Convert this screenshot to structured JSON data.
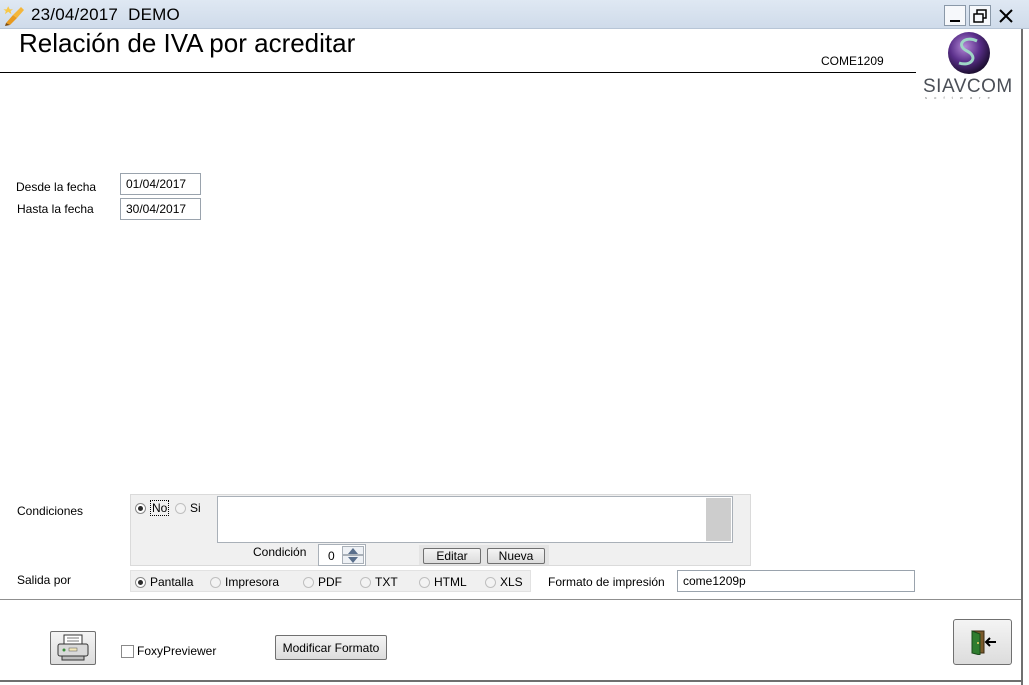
{
  "window": {
    "date": "23/04/2017",
    "company": "DEMO"
  },
  "header": {
    "title": "Relación de IVA por acreditar",
    "code": "COME1209",
    "logo_text": "SIAVCOM",
    "logo_subtext": "s o f t w a r e"
  },
  "dates": {
    "from_label": "Desde la fecha",
    "from_value": "01/04/2017",
    "to_label": "Hasta la fecha",
    "to_value": "30/04/2017"
  },
  "conditions": {
    "label": "Condiciones",
    "option_no": "No",
    "option_si": "Si",
    "condition_label": "Condición",
    "condition_value": "0",
    "edit_button": "Editar",
    "new_button": "Nueva"
  },
  "output": {
    "label": "Salida por",
    "options": [
      "Pantalla",
      "Impresora",
      "PDF",
      "TXT",
      "HTML",
      "XLS"
    ],
    "selected": "Pantalla",
    "format_label": "Formato de impresión",
    "format_value": "come1209p"
  },
  "footer": {
    "foxy_label": "FoxyPreviewer",
    "modify_format_button": "Modificar Formato"
  },
  "icons": {
    "app": "pencil-star-icon",
    "print": "printer-icon",
    "exit": "exit-door-icon"
  },
  "colors": {
    "titlebar": "#d5e0ee",
    "logo": "#4b2a77",
    "exit_door": "#2f7d2f"
  }
}
